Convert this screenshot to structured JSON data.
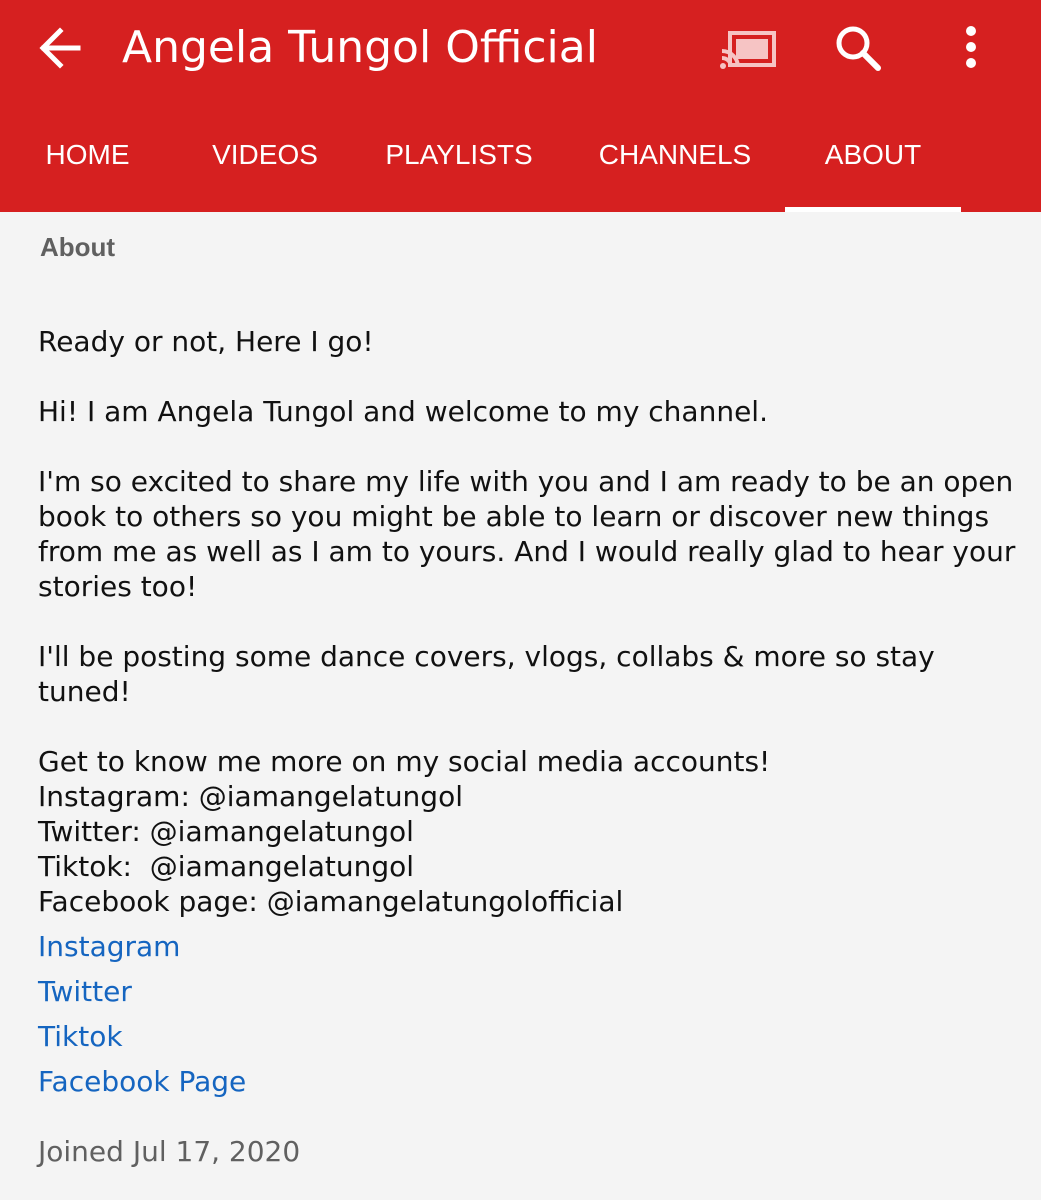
{
  "header": {
    "title": "Angela Tungol Official",
    "background_color": "#d62020",
    "icons": {
      "back": "arrow-left-icon",
      "cast": "cast-icon",
      "search": "search-icon",
      "more": "more-vertical-icon"
    }
  },
  "tabs": [
    {
      "label": "HOME",
      "active": false
    },
    {
      "label": "VIDEOS",
      "active": false
    },
    {
      "label": "PLAYLISTS",
      "active": false
    },
    {
      "label": "CHANNELS",
      "active": false
    },
    {
      "label": "ABOUT",
      "active": true
    }
  ],
  "about": {
    "heading": "About",
    "description": {
      "tagline": "Ready or not, Here I go!",
      "greeting": "Hi! I am Angela Tungol and welcome to my channel.",
      "paragraph_lines": [
        "I'm so excited to share my life with you and I am ready to be an open",
        "book to others so you might be able to learn or discover new things",
        "from me as well as I am to yours. And I would really glad to hear your",
        "stories too!"
      ],
      "posting": "I'll be posting some dance covers, vlogs, collabs & more so stay tuned!",
      "social_lines": [
        "Get to know me more on my social media accounts!",
        "Instagram: @iamangelatungol",
        "Twitter: @iamangelatungol",
        "Tiktok:  @iamangelatungol",
        "Facebook page: @iamangelatungolofficial"
      ]
    },
    "links": [
      "Instagram",
      "Twitter",
      "Tiktok",
      "Facebook Page"
    ],
    "link_color": "#1565c0",
    "joined": "Joined Jul 17, 2020"
  }
}
